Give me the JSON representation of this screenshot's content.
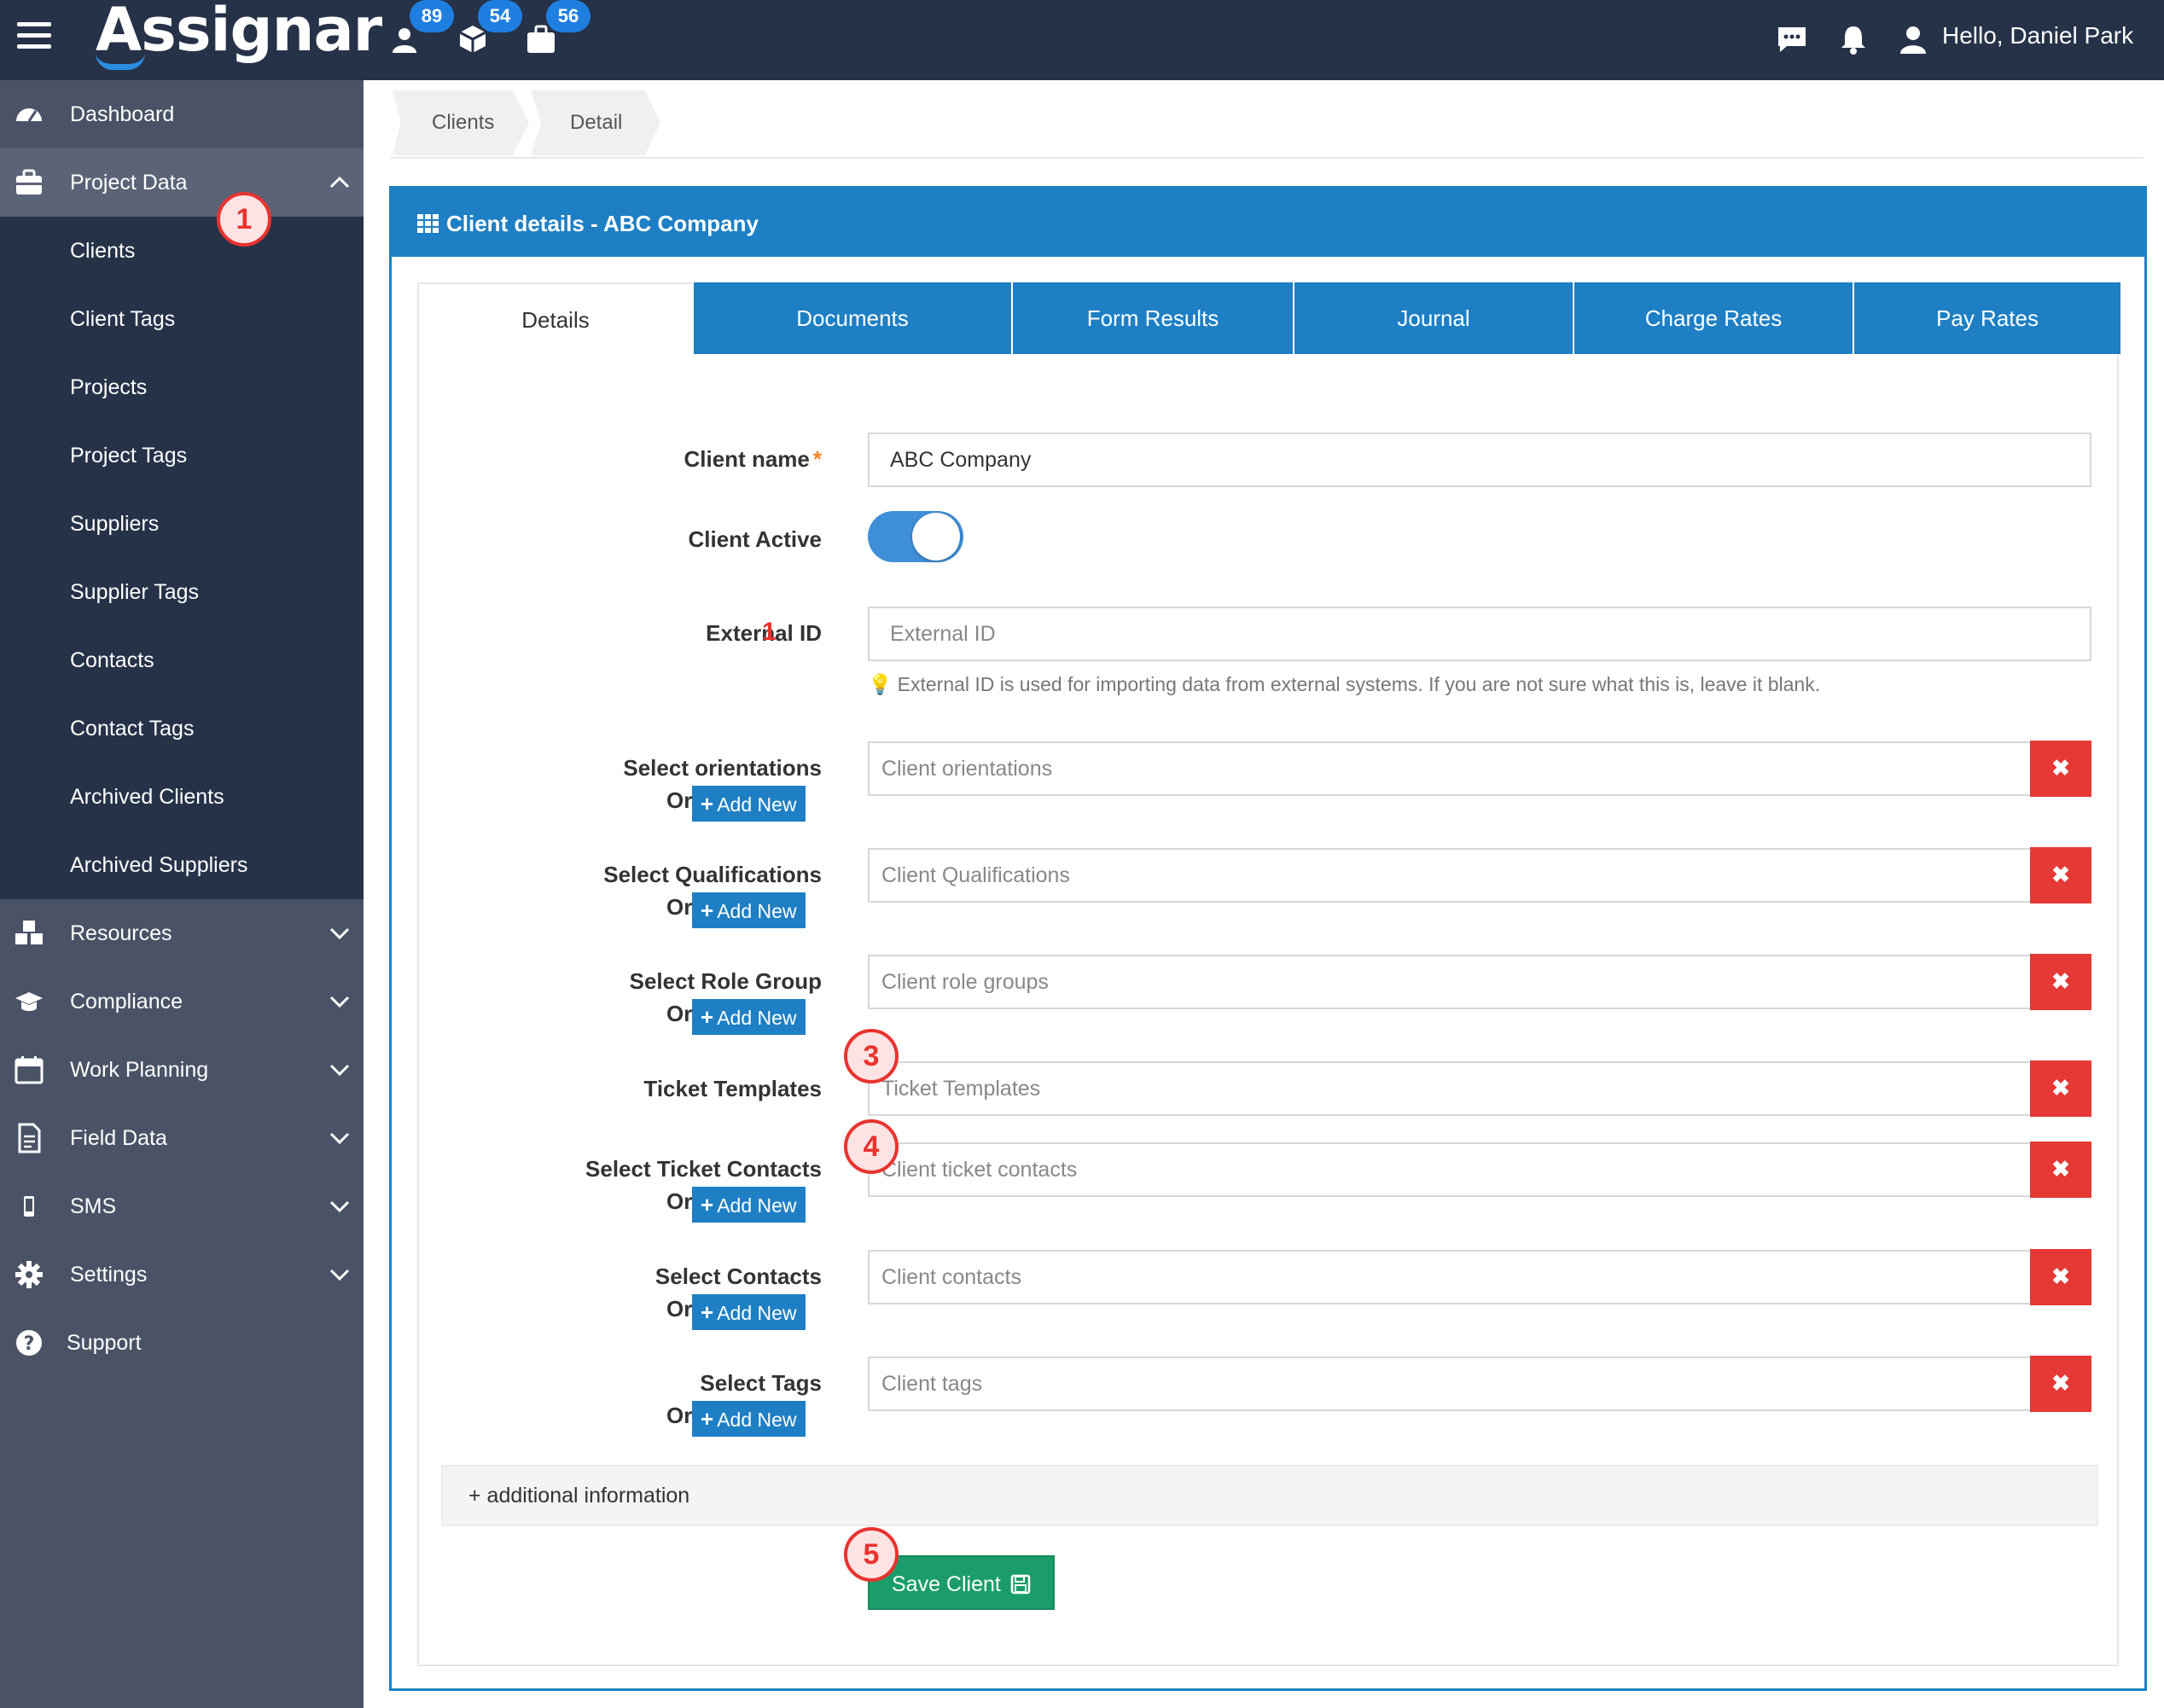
{
  "header": {
    "logo": "Assignar",
    "badges": {
      "people": "89",
      "assets": "54",
      "jobs": "56"
    },
    "greeting": "Hello, Daniel Park"
  },
  "sidebar": {
    "dashboard": "Dashboard",
    "project_data": "Project Data",
    "sub_items": [
      "Clients",
      "Client Tags",
      "Projects",
      "Project Tags",
      "Suppliers",
      "Supplier Tags",
      "Contacts",
      "Contact Tags",
      "Archived Clients",
      "Archived Suppliers"
    ],
    "sections": [
      "Resources",
      "Compliance",
      "Work Planning",
      "Field Data",
      "SMS",
      "Settings"
    ],
    "support": "Support"
  },
  "steps": [
    "1",
    "1",
    "3",
    "4",
    "5"
  ],
  "breadcrumb": [
    "Clients",
    "Detail"
  ],
  "panel": {
    "title": "Client details - ABC Company",
    "tabs": [
      "Details",
      "Documents",
      "Form Results",
      "Journal",
      "Charge Rates",
      "Pay Rates"
    ]
  },
  "form": {
    "client_name_label": "Client name",
    "required_mark": "*",
    "client_name_value": "ABC Company",
    "client_active_label": "Client Active",
    "client_active": true,
    "external_id_label": "External ID",
    "external_id_placeholder": "External ID",
    "external_id_help": "External ID is used for importing data from external systems. If you are not sure what this is, leave it blank.",
    "or_text": "Or",
    "add_new": "Add New",
    "orientations_label": "Select orientations",
    "orientations_placeholder": "Client orientations",
    "qualifications_label": "Select Qualifications",
    "qualifications_placeholder": "Client Qualifications",
    "role_group_label": "Select Role Group",
    "role_group_placeholder": "Client role groups",
    "ticket_templates_label": "Ticket Templates",
    "ticket_templates_placeholder": "Ticket Templates",
    "ticket_contacts_label": "Select Ticket Contacts",
    "ticket_contacts_placeholder": "Client ticket contacts",
    "contacts_label": "Select Contacts",
    "contacts_placeholder": "Client contacts",
    "tags_label": "Select Tags",
    "tags_placeholder": "Client tags",
    "clear_symbol": "✖",
    "additional_info": "+ additional information",
    "save_label": "Save Client"
  }
}
